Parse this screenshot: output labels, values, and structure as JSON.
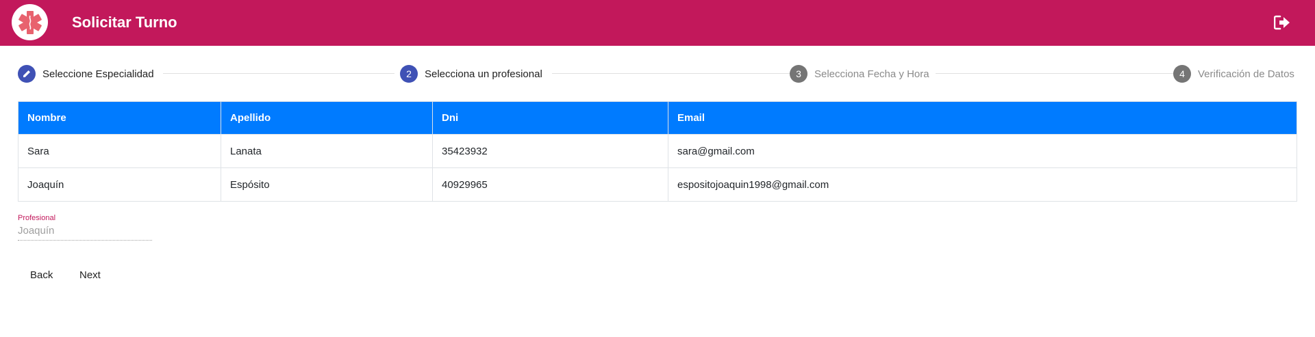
{
  "header": {
    "title": "Solicitar Turno",
    "brand_color": "#c2185b",
    "logo_icon": "medical-star-icon",
    "logout_icon": "sign-out-icon"
  },
  "stepper": {
    "steps": [
      {
        "marker": "edit",
        "label": "Seleccione Especialidad",
        "state": "done"
      },
      {
        "marker": "2",
        "label": "Selecciona un profesional",
        "state": "current"
      },
      {
        "marker": "3",
        "label": "Selecciona Fecha y Hora",
        "state": "pending"
      },
      {
        "marker": "4",
        "label": "Verificación de Datos",
        "state": "pending"
      }
    ],
    "active_color": "#3f51b5",
    "inactive_color": "#757575"
  },
  "table": {
    "header_color": "#007bff",
    "columns": [
      "Nombre",
      "Apellido",
      "Dni",
      "Email"
    ],
    "rows": [
      [
        "Sara",
        "Lanata",
        "35423932",
        "sara@gmail.com"
      ],
      [
        "Joaquín",
        "Espósito",
        "40929965",
        "espositojoaquin1998@gmail.com"
      ]
    ]
  },
  "form": {
    "profesional_label": "Profesional",
    "profesional_value": "Joaquín"
  },
  "actions": {
    "back_label": "Back",
    "next_label": "Next"
  }
}
